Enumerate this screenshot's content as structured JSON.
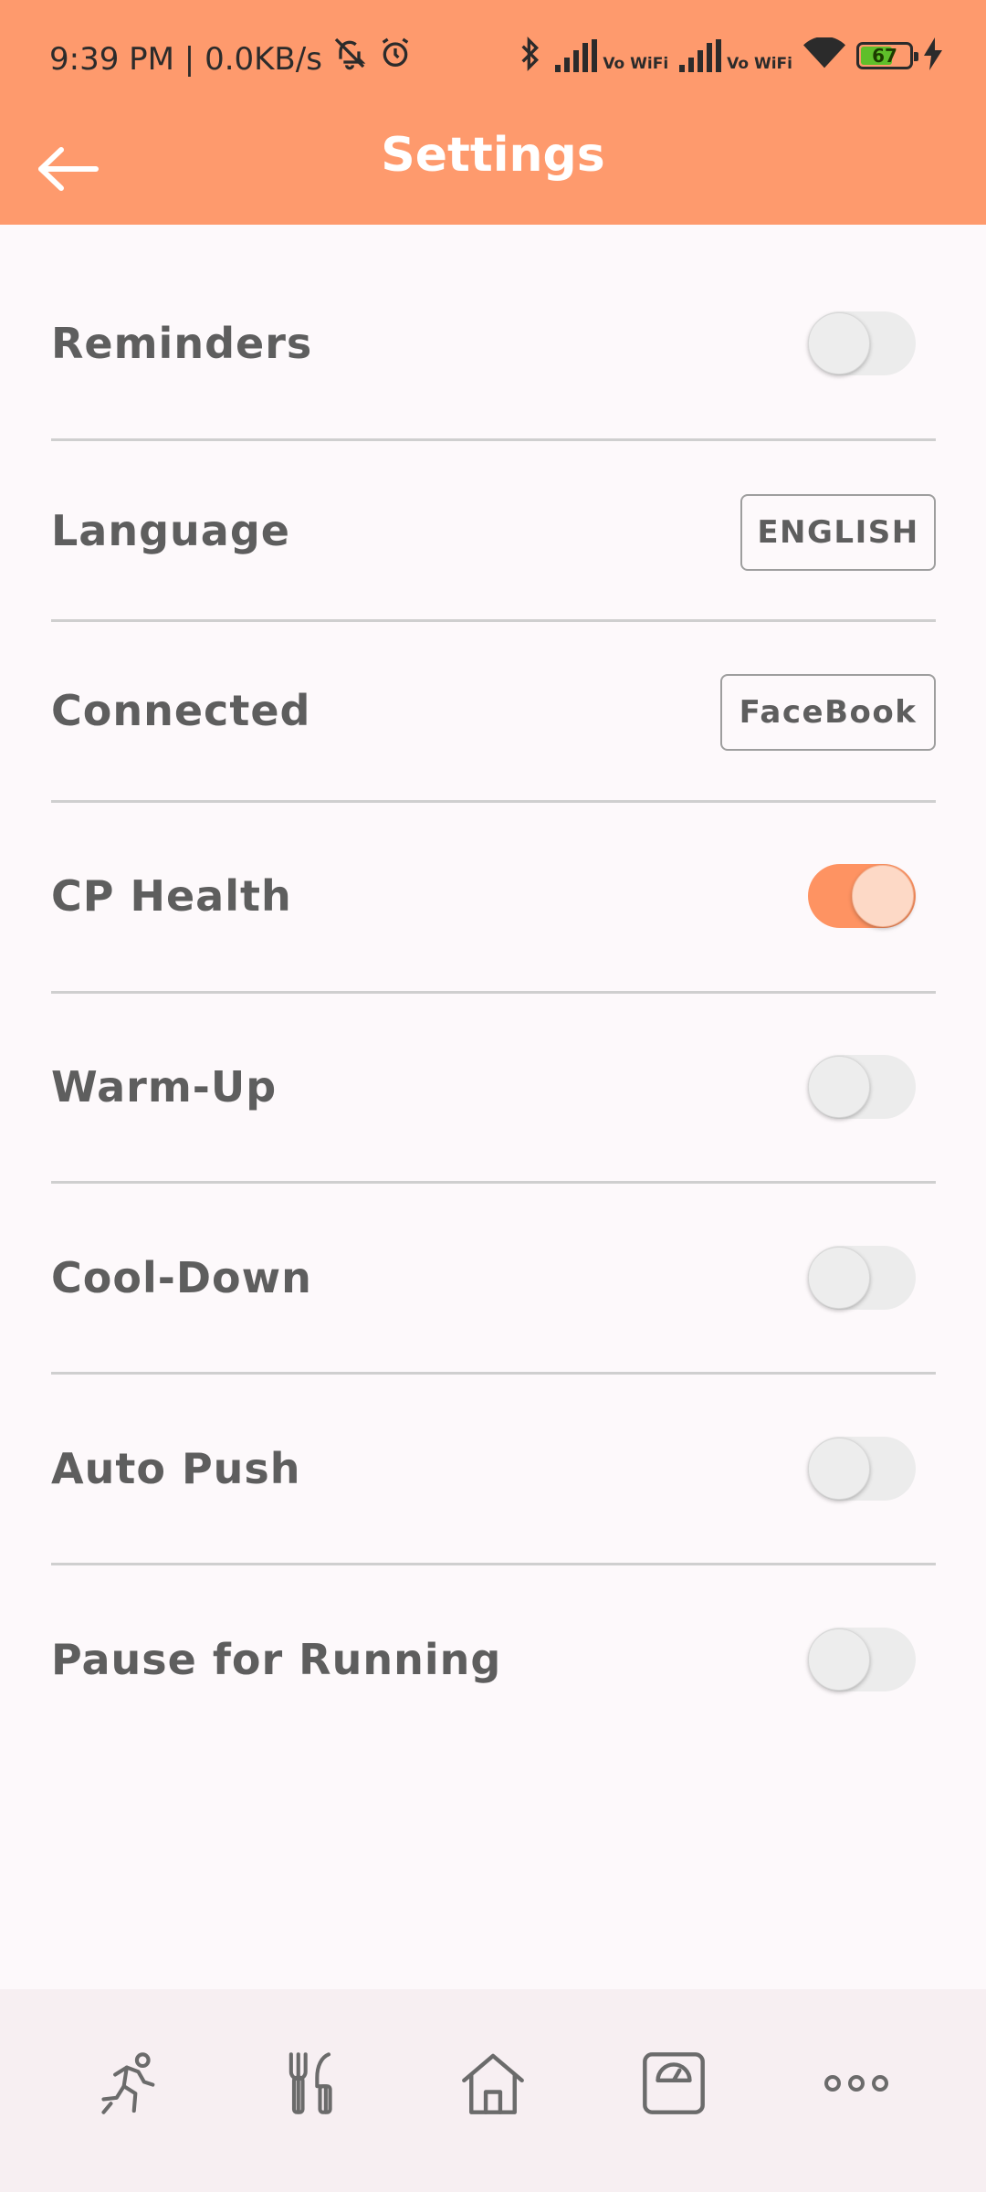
{
  "status_bar": {
    "time_speed": "9:39 PM | 0.0KB/s",
    "vowifi_1": "Vo WiFi",
    "vowifi_2": "Vo WiFi",
    "battery_level": "67",
    "battery_fraction": 0.67,
    "icons": [
      "mute-icon",
      "alarm-icon",
      "bluetooth-icon",
      "signal-icon",
      "wifi-icon",
      "battery-icon",
      "charging-icon"
    ]
  },
  "header": {
    "title": "Settings",
    "back_icon": "back-arrow-icon",
    "background_color": "#fe9a6d"
  },
  "settings": {
    "reminders": {
      "label": "Reminders",
      "on": false
    },
    "language": {
      "label": "Language",
      "button": "ENGLISH"
    },
    "connected": {
      "label": "Connected",
      "button": "FaceBook"
    },
    "cp_health": {
      "label": "CP Health",
      "on": true
    },
    "warm_up": {
      "label": "Warm-Up",
      "on": false
    },
    "cool_down": {
      "label": "Cool-Down",
      "on": false
    },
    "auto_push": {
      "label": "Auto Push",
      "on": false
    },
    "pause_for_running": {
      "label": "Pause for Running",
      "on": false
    }
  },
  "bottom_nav": {
    "items": [
      "running-icon",
      "fork-knife-icon",
      "home-icon",
      "scale-icon",
      "more-icon"
    ]
  },
  "colors": {
    "accent": "#fe9362",
    "text": "#5e5e5e",
    "divider": "#cfcfcf",
    "nav_icon": "#6b6b6b"
  }
}
